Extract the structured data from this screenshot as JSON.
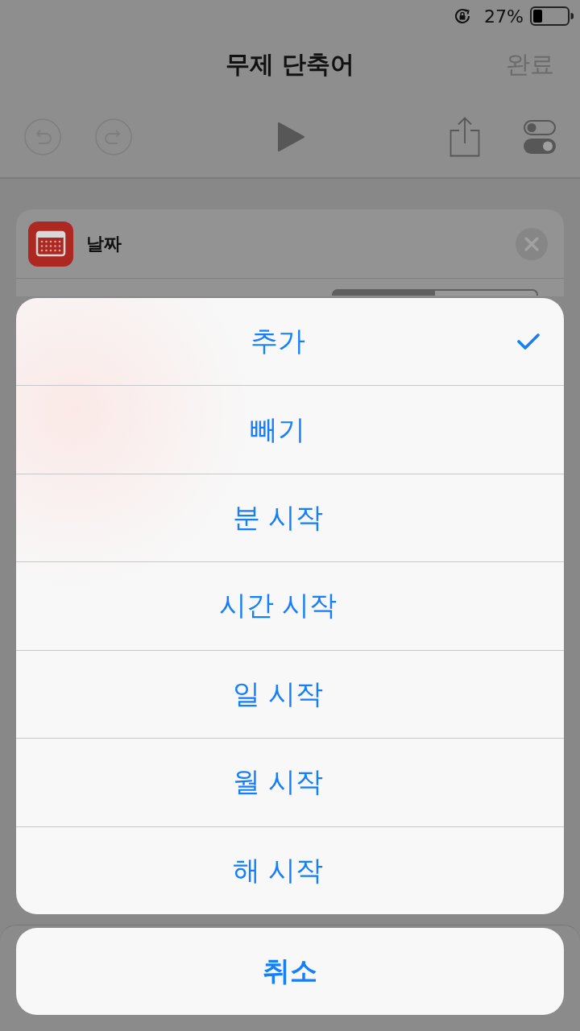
{
  "status_bar": {
    "battery_percent": "27%"
  },
  "nav_bar": {
    "title": "무제 단축어",
    "done": "완료"
  },
  "toolbar": {
    "buttons": [
      {
        "kind": "undo",
        "disabled": true
      },
      {
        "kind": "redo",
        "disabled": true
      },
      {
        "kind": "play",
        "disabled": false
      },
      {
        "kind": "share",
        "disabled": false
      },
      {
        "kind": "settings",
        "disabled": false
      }
    ]
  },
  "action_card": {
    "title": "날짜",
    "segments": [
      {
        "selected": true
      },
      {
        "selected": false
      }
    ]
  },
  "action_sheet": {
    "options": [
      {
        "label": "추가",
        "selected": true
      },
      {
        "label": "빼기",
        "selected": false
      },
      {
        "label": "분 시작",
        "selected": false
      },
      {
        "label": "시간 시작",
        "selected": false
      },
      {
        "label": "일 시작",
        "selected": false
      },
      {
        "label": "월 시작",
        "selected": false
      },
      {
        "label": "해 시작",
        "selected": false
      }
    ],
    "cancel": "취소"
  }
}
